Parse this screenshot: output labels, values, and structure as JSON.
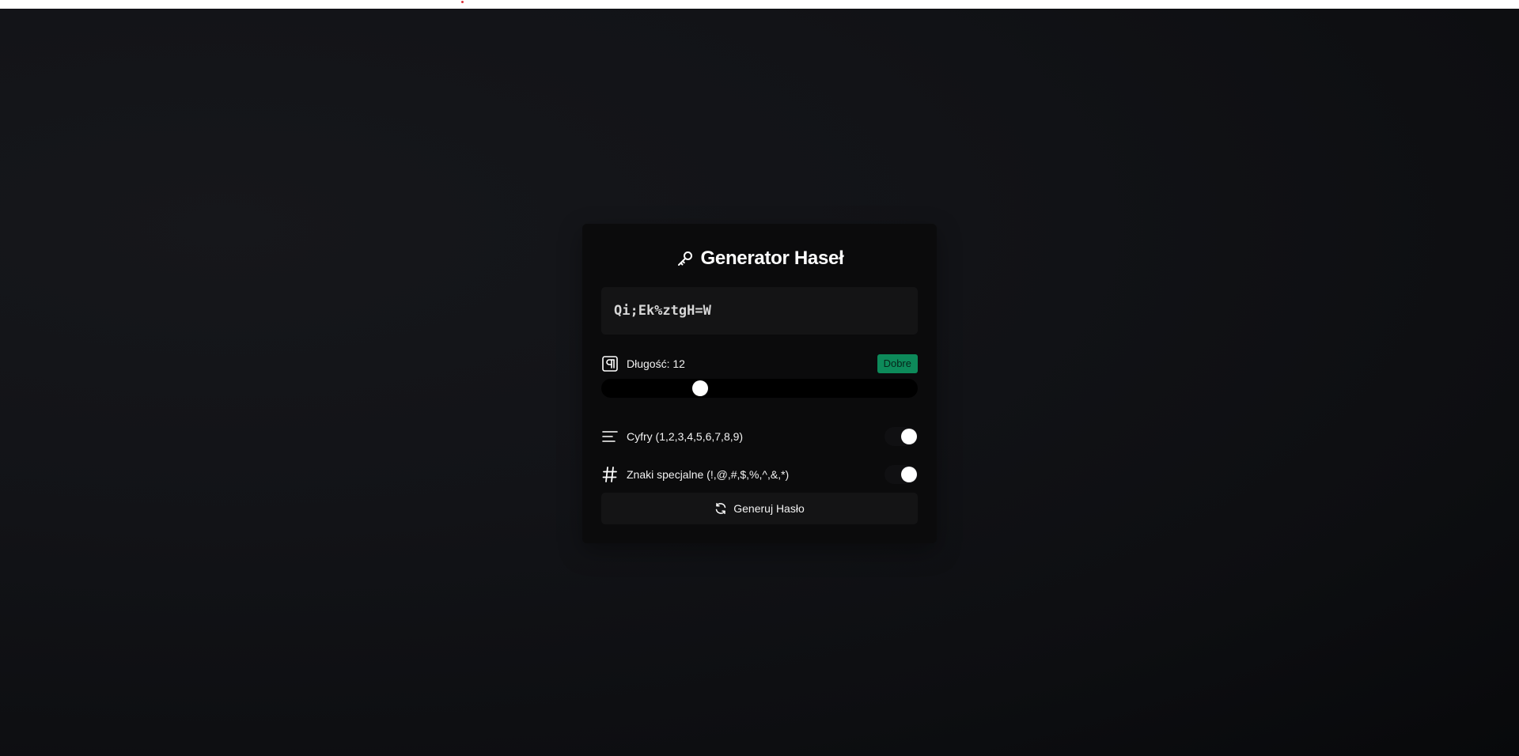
{
  "colors": {
    "accent_badge": "#0d8a5a",
    "top_dot": "#d9323a"
  },
  "header": {
    "title": "Generator Haseł",
    "icon": "key-icon"
  },
  "password": {
    "value": "Qi;Ek%ztgH=W"
  },
  "length": {
    "label": "Długość: 12",
    "icon": "pilcrow-icon",
    "strength_badge": "Dobre",
    "slider_fraction": 0.3
  },
  "options": [
    {
      "label": "Cyfry (1,2,3,4,5,6,7,8,9)",
      "icon": "align-left-icon",
      "enabled": true
    },
    {
      "label": "Znaki specjalne (!,@,#,$,%,^,&,*)",
      "icon": "hash-icon",
      "enabled": true
    }
  ],
  "generate_button": {
    "label": "Generuj Hasło",
    "icon": "refresh-icon"
  }
}
